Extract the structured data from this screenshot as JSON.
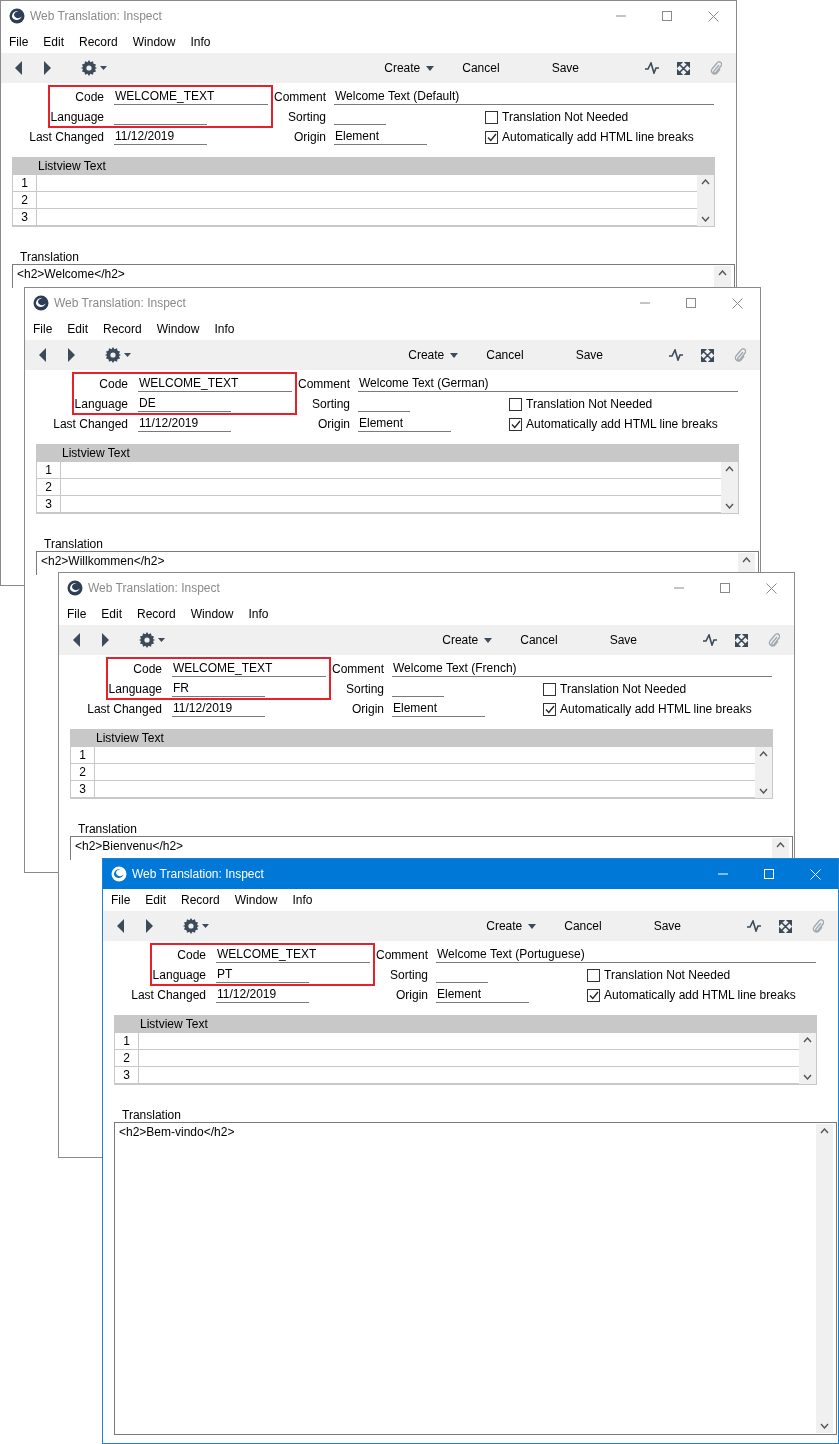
{
  "windows": [
    {
      "title": "Web Translation: Inspect",
      "active": false,
      "highlight": true,
      "menu": [
        "File",
        "Edit",
        "Record",
        "Window",
        "Info"
      ],
      "toolbar": [
        {
          "label": "Create",
          "kind": "dropdown"
        },
        {
          "label": "Cancel",
          "kind": "plain"
        },
        {
          "label": "Save",
          "kind": "plain"
        }
      ],
      "code": {
        "label": "Code",
        "value": "WELCOME_TEXT"
      },
      "language": {
        "label": "Language"
      },
      "last_changed": {
        "label": "Last Changed",
        "value": "11/12/2019"
      },
      "comment": {
        "label": "Comment",
        "value": "Welcome Text (Default)"
      },
      "sorting": {
        "label": "Sorting"
      },
      "origin": {
        "label": "Origin",
        "value": "Element"
      },
      "checkboxes": [
        {
          "label": "Translation Not Needed",
          "checked": false
        },
        {
          "label": "Automatically add HTML line breaks",
          "checked": true
        }
      ],
      "listview": {
        "header": "Listview Text",
        "rows": [
          "1",
          "2",
          "3"
        ]
      },
      "translation": {
        "label": "Translation",
        "text": "<h2>Welcome</h2>"
      }
    },
    {
      "title": "Web Translation: Inspect",
      "active": false,
      "highlight": true,
      "menu": [
        "File",
        "Edit",
        "Record",
        "Window",
        "Info"
      ],
      "toolbar": [
        {
          "label": "Create",
          "kind": "dropdown"
        },
        {
          "label": "Cancel",
          "kind": "plain"
        },
        {
          "label": "Save",
          "kind": "plain"
        }
      ],
      "code": {
        "label": "Code",
        "value": "WELCOME_TEXT"
      },
      "language": {
        "label": "Language",
        "value": "DE"
      },
      "last_changed": {
        "label": "Last Changed",
        "value": "11/12/2019"
      },
      "comment": {
        "label": "Comment",
        "value": "Welcome Text (German)"
      },
      "sorting": {
        "label": "Sorting"
      },
      "origin": {
        "label": "Origin",
        "value": "Element"
      },
      "checkboxes": [
        {
          "label": "Translation Not Needed",
          "checked": false
        },
        {
          "label": "Automatically add HTML line breaks",
          "checked": true
        }
      ],
      "listview": {
        "header": "Listview Text",
        "rows": [
          "1",
          "2",
          "3"
        ]
      },
      "translation": {
        "label": "Translation",
        "text": "<h2>Willkommen</h2>"
      }
    },
    {
      "title": "Web Translation: Inspect",
      "active": false,
      "highlight": true,
      "menu": [
        "File",
        "Edit",
        "Record",
        "Window",
        "Info"
      ],
      "toolbar": [
        {
          "label": "Create",
          "kind": "dropdown"
        },
        {
          "label": "Cancel",
          "kind": "plain"
        },
        {
          "label": "Save",
          "kind": "plain"
        }
      ],
      "code": {
        "label": "Code",
        "value": "WELCOME_TEXT"
      },
      "language": {
        "label": "Language",
        "value": "FR"
      },
      "last_changed": {
        "label": "Last Changed",
        "value": "11/12/2019"
      },
      "comment": {
        "label": "Comment",
        "value": "Welcome Text (French)"
      },
      "sorting": {
        "label": "Sorting"
      },
      "origin": {
        "label": "Origin",
        "value": "Element"
      },
      "checkboxes": [
        {
          "label": "Translation Not Needed",
          "checked": false
        },
        {
          "label": "Automatically add HTML line breaks",
          "checked": true
        }
      ],
      "listview": {
        "header": "Listview Text",
        "rows": [
          "1",
          "2",
          "3"
        ]
      },
      "translation": {
        "label": "Translation",
        "text": "<h2>Bienvenu</h2>"
      }
    },
    {
      "title": "Web Translation: Inspect",
      "active": true,
      "highlight": true,
      "menu": [
        "File",
        "Edit",
        "Record",
        "Window",
        "Info"
      ],
      "toolbar": [
        {
          "label": "Create",
          "kind": "dropdown"
        },
        {
          "label": "Cancel",
          "kind": "plain"
        },
        {
          "label": "Save",
          "kind": "plain"
        }
      ],
      "code": {
        "label": "Code",
        "value": "WELCOME_TEXT"
      },
      "language": {
        "label": "Language",
        "value": "PT"
      },
      "last_changed": {
        "label": "Last Changed",
        "value": "11/12/2019"
      },
      "comment": {
        "label": "Comment",
        "value": "Welcome Text (Portuguese)"
      },
      "sorting": {
        "label": "Sorting"
      },
      "origin": {
        "label": "Origin",
        "value": "Element"
      },
      "checkboxes": [
        {
          "label": "Translation Not Needed",
          "checked": false
        },
        {
          "label": "Automatically add HTML line breaks",
          "checked": true
        }
      ],
      "listview": {
        "header": "Listview Text",
        "rows": [
          "1",
          "2",
          "3"
        ]
      },
      "translation": {
        "label": "Translation",
        "text": "<h2>Bem-vindo</h2>"
      }
    }
  ]
}
